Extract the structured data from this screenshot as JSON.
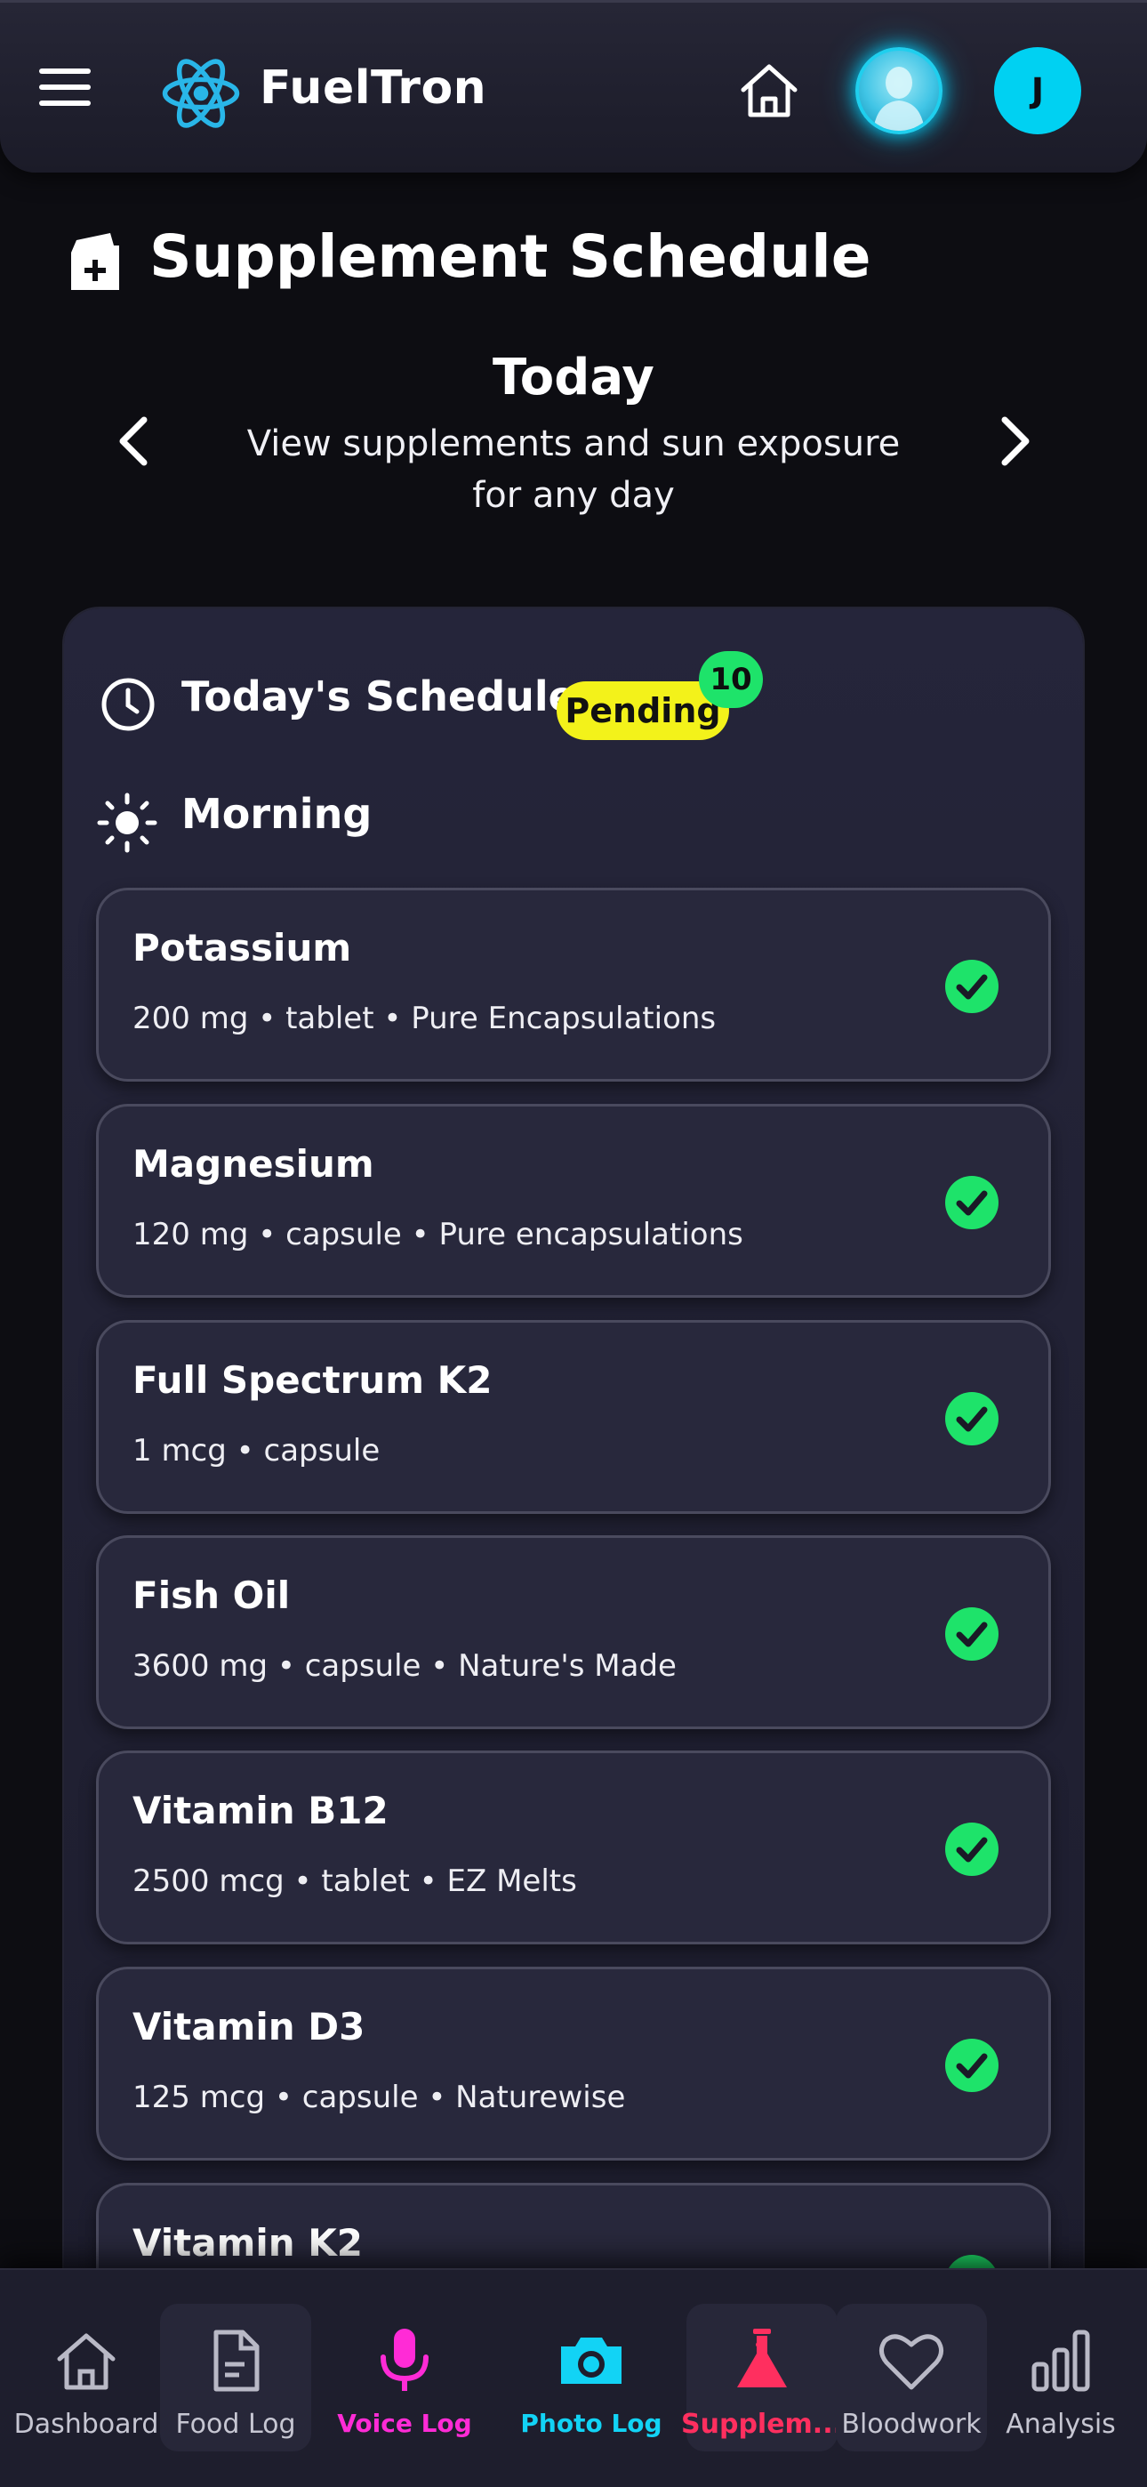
{
  "header": {
    "brand": "FuelTron",
    "user_initial": "J"
  },
  "page": {
    "title": "Supplement Schedule",
    "date_label": "Today",
    "date_subtitle": "View supplements and sun exposure for any day"
  },
  "schedule": {
    "title": "Today's Schedule",
    "status": "Pending",
    "count": "10",
    "section": "Morning",
    "items": [
      {
        "name": "Potassium",
        "detail": "200 mg • tablet • Pure Encapsulations"
      },
      {
        "name": "Magnesium",
        "detail": "120 mg • capsule • Pure encapsulations"
      },
      {
        "name": "Full Spectrum K2",
        "detail": "1 mcg • capsule"
      },
      {
        "name": "Fish Oil",
        "detail": "3600 mg • capsule • Nature's Made"
      },
      {
        "name": "Vitamin B12",
        "detail": "2500 mcg • tablet • EZ Melts"
      },
      {
        "name": "Vitamin D3",
        "detail": "125 mcg • capsule • Naturewise"
      },
      {
        "name": "Vitamin K2",
        "detail": ""
      }
    ]
  },
  "nav": {
    "items": [
      {
        "label": "Dashboard",
        "icon": "home-icon"
      },
      {
        "label": "Food Log",
        "icon": "document-icon"
      },
      {
        "label": "Voice Log",
        "icon": "microphone-icon",
        "color": "#ff2bd6"
      },
      {
        "label": "Photo Log",
        "icon": "camera-icon",
        "color": "#12d3f5"
      },
      {
        "label": "Supplem...",
        "icon": "flask-icon",
        "color": "#ff2f5f"
      },
      {
        "label": "Bloodwork",
        "icon": "heart-icon"
      },
      {
        "label": "Analysis",
        "icon": "bar-chart-icon"
      }
    ]
  },
  "colors": {
    "background": "#0d0d12",
    "accent_cyan": "#00d1f2",
    "check_green": "#1ee36a",
    "pending_yellow": "#f3f21a"
  }
}
